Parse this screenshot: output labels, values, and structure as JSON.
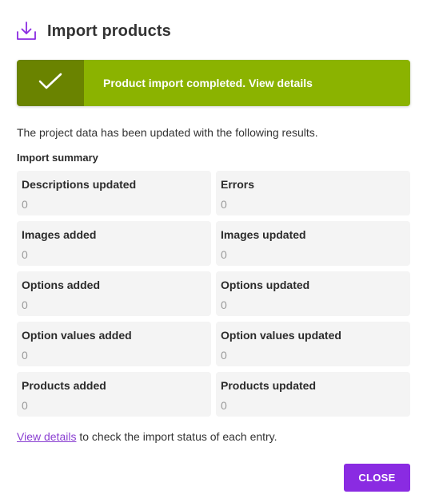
{
  "dialog": {
    "title": "Import products",
    "icon": "download-tray-icon",
    "accent_color": "#8a2be2"
  },
  "banner": {
    "icon": "checkmark-icon",
    "message": "Product import completed. View details",
    "status_color": "#8bb300",
    "status_dark_color": "#6a8300"
  },
  "intro_text": "The project data has been updated with the following results.",
  "summary": {
    "title": "Import summary",
    "items": [
      {
        "label": "Descriptions updated",
        "value": "0"
      },
      {
        "label": "Errors",
        "value": "0"
      },
      {
        "label": "Images added",
        "value": "0"
      },
      {
        "label": "Images updated",
        "value": "0"
      },
      {
        "label": "Options added",
        "value": "0"
      },
      {
        "label": "Options updated",
        "value": "0"
      },
      {
        "label": "Option values added",
        "value": "0"
      },
      {
        "label": "Option values updated",
        "value": "0"
      },
      {
        "label": "Products added",
        "value": "0"
      },
      {
        "label": "Products updated",
        "value": "0"
      }
    ]
  },
  "footer": {
    "link_text": "View details",
    "text": " to check the import status of each entry."
  },
  "close_label": "CLOSE"
}
